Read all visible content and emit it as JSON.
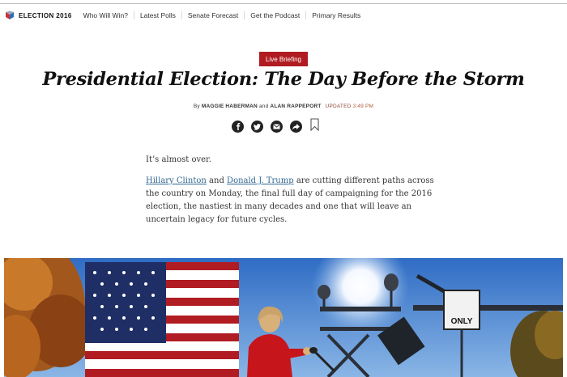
{
  "nav": {
    "brand": "ELECTION 2016",
    "items": [
      "Who Will Win?",
      "Latest Polls",
      "Senate Forecast",
      "Get the Podcast",
      "Primary Results"
    ]
  },
  "badge": "Live Briefing",
  "headline": "Presidential Election: The Day Before the Storm",
  "byline": {
    "prefix": "By",
    "author1": "MAGGIE HABERMAN",
    "and": "and",
    "author2": "ALAN RAPPEPORT",
    "updated_label": "UPDATED",
    "updated_time": "3:49 PM"
  },
  "share_icons": [
    "facebook-icon",
    "twitter-icon",
    "email-icon",
    "share-arrow-icon",
    "bookmark-icon"
  ],
  "article": {
    "p1": "It’s almost over.",
    "link1": "Hillary Clinton",
    "and": "and",
    "link2": "Donald J. Trump",
    "p2_rest": "are cutting different paths across the country on Monday, the final full day of campaigning for the 2016 election, the nastiest in many decades and one that will leave an uncertain legacy for future cycles."
  },
  "photo": {
    "sign_text": "ONLY"
  },
  "colors": {
    "badge": "#b01c21",
    "link": "#326891",
    "sky": "#3f7fd0"
  }
}
